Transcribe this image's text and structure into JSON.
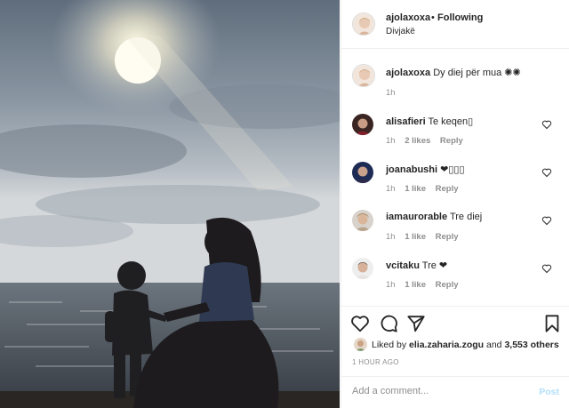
{
  "header": {
    "username": "ajolaxoxa",
    "separator": "•",
    "follow_status": "Following",
    "location": "Divjakë"
  },
  "caption": {
    "username": "ajolaxoxa",
    "text": "Dy diej për mua ✺✺",
    "time": "1h"
  },
  "comments": [
    {
      "username": "alisafieri",
      "text": "Te keqen▯",
      "time": "1h",
      "likes": "2 likes",
      "reply": "Reply"
    },
    {
      "username": "joanabushi",
      "text": "❤▯▯▯",
      "time": "1h",
      "likes": "1 like",
      "reply": "Reply"
    },
    {
      "username": "iamaurorable",
      "text": "Tre diej",
      "time": "1h",
      "likes": "1 like",
      "reply": "Reply"
    },
    {
      "username": "vcitaku",
      "text": "Tre ❤",
      "time": "1h",
      "likes": "1 like",
      "reply": "Reply"
    }
  ],
  "likes": {
    "prefix": "Liked by",
    "user": "elia.zaharia.zogu",
    "conjunction": "and",
    "others": "3,553 others"
  },
  "time_ago": "1 HOUR AGO",
  "add_comment": {
    "placeholder": "Add a comment...",
    "post_label": "Post"
  },
  "icons": [
    "heart-icon",
    "comment-icon",
    "share-icon",
    "bookmark-icon"
  ],
  "colors": {
    "post_button": "#b2dffc",
    "meta_gray": "#8e8e8e",
    "text": "#262626"
  }
}
